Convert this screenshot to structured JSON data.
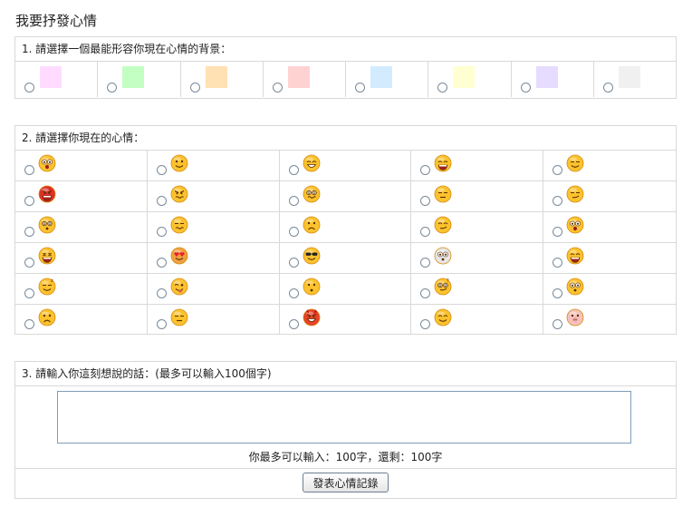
{
  "page_title": "我要抒發心情",
  "section1": {
    "title": "1. 請選擇一個最能形容你現在心情的背景：",
    "swatches": [
      "#ffdcff",
      "#c3ffc3",
      "#ffe1b4",
      "#ffd2d2",
      "#d2ebff",
      "#ffffd2",
      "#e6dcff",
      "#f0f0f0"
    ]
  },
  "section2": {
    "title": "2. 請選擇你現在的心情：",
    "moods": [
      "shocked-face-icon",
      "smile-face-icon",
      "grin-face-icon",
      "laugh-face-icon",
      "shy-face-icon",
      "angry-face-icon",
      "frustrated-face-icon",
      "confused-face-icon",
      "annoyed-face-icon",
      "unamused-face-icon",
      "dizzy-face-icon",
      "sweat-face-icon",
      "worried-face-icon",
      "sly-face-icon",
      "scared-face-icon",
      "yelling-face-icon",
      "heart-eyes-face-icon",
      "cool-sunglasses-face-icon",
      "ghost-face-icon",
      "crying-face-icon",
      "sleepy-face-icon",
      "tongue-face-icon",
      "sheepish-face-icon",
      "thinking-face-icon",
      "surprised-face-icon",
      "sad-face-icon",
      "expressionless-face-icon",
      "devil-face-icon",
      "drooling-face-icon",
      "pig-face-icon"
    ]
  },
  "section3": {
    "title": "3. 請輸入你這刻想說的話：(最多可以輸入100個字)",
    "textarea_value": "",
    "counter_text": "你最多可以輸入：100字，還剩：100字",
    "submit_label": "發表心情記錄"
  }
}
